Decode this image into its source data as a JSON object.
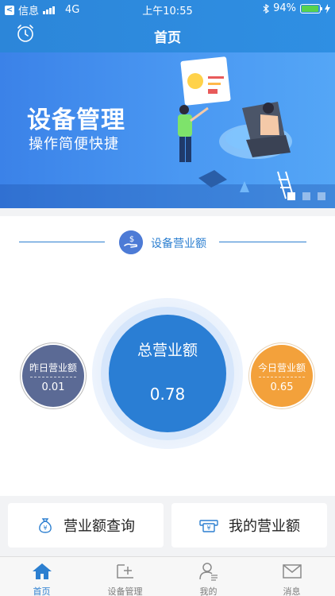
{
  "status_bar": {
    "carrier": "信息",
    "network": "4G",
    "time": "上午10:55",
    "battery": "94%",
    "battery_level": 0.94
  },
  "header": {
    "title": "首页",
    "left_icon": "alarm-clock-icon"
  },
  "banner": {
    "title": "设备管理",
    "subtitle": "操作简便快捷",
    "page_count": 3,
    "active_page": 1
  },
  "section": {
    "title": "设备营业额",
    "icon": "money-hand-icon"
  },
  "revenue": {
    "total": {
      "label": "总营业额",
      "value": "0.78"
    },
    "yesterday": {
      "label": "昨日营业额",
      "value": "0.01"
    },
    "today": {
      "label": "今日营业额",
      "value": "0.65"
    }
  },
  "actions": {
    "query_label": "营业额查询",
    "mine_label": "我的营业额"
  },
  "tabs": [
    {
      "label": "首页",
      "icon": "home-icon",
      "active": true
    },
    {
      "label": "设备管理",
      "icon": "add-device-icon",
      "active": false
    },
    {
      "label": "我的",
      "icon": "user-icon",
      "active": false
    },
    {
      "label": "消息",
      "icon": "mail-icon",
      "active": false
    }
  ],
  "colors": {
    "primary": "#2c7fd0",
    "yesterday": "#5b6a95",
    "today": "#f3a13b",
    "total": "#2a7ed4"
  }
}
